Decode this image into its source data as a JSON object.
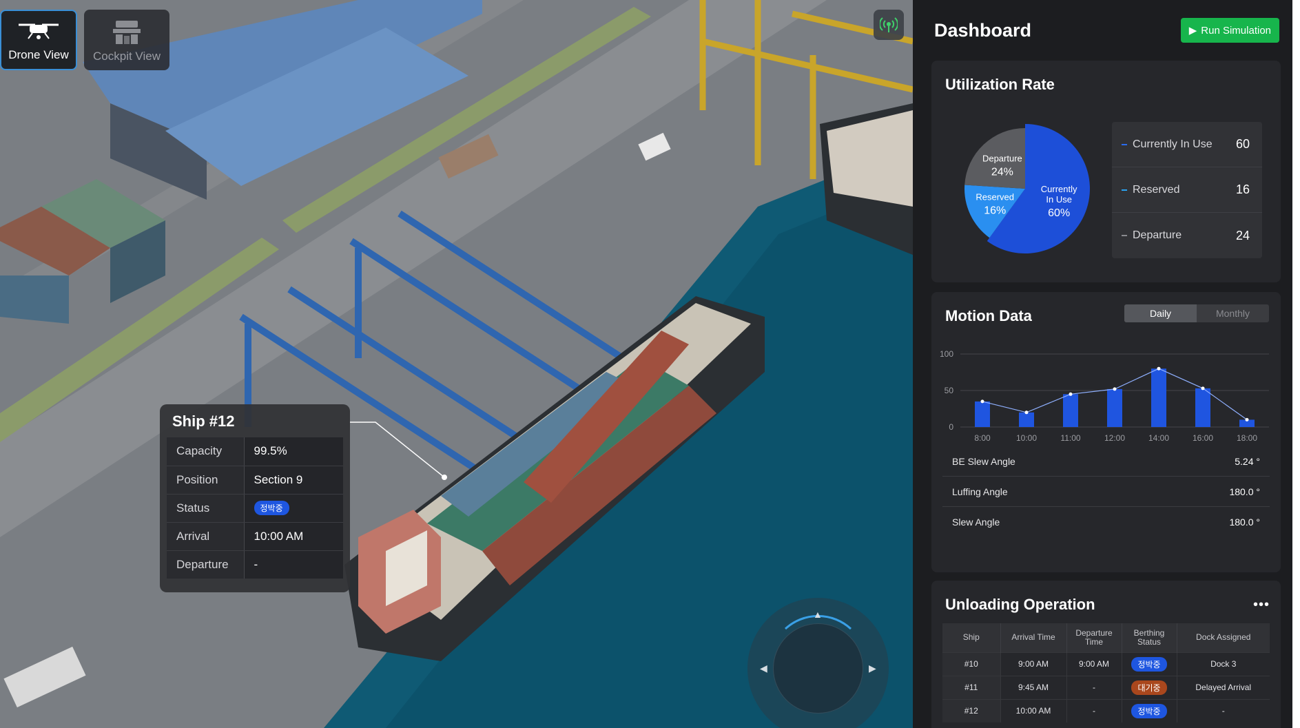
{
  "view_switch": {
    "drone_label": "Drone View",
    "cockpit_label": "Cockpit View",
    "active": "Drone View"
  },
  "ship_card": {
    "title": "Ship #12",
    "rows": [
      {
        "key": "Capacity",
        "value": "99.5%"
      },
      {
        "key": "Position",
        "value": "Section 9"
      },
      {
        "key": "Status",
        "value": "정박중",
        "badge": true
      },
      {
        "key": "Arrival",
        "value": "10:00 AM"
      },
      {
        "key": "Departure",
        "value": "-"
      }
    ]
  },
  "dashboard": {
    "title": "Dashboard",
    "run_button": "Run Simulation"
  },
  "utilization": {
    "title": "Utilization Rate",
    "slices": [
      {
        "label_line1": "Currently",
        "label_line2": "In Use",
        "pct_label": "60%",
        "value": 60,
        "color": "#1d4fd8"
      },
      {
        "label_line1": "Reserved",
        "label_line2": "",
        "pct_label": "16%",
        "value": 16,
        "color": "#2a8ff0"
      },
      {
        "label_line1": "Departure",
        "label_line2": "",
        "pct_label": "24%",
        "value": 24,
        "color": "#5b5c60"
      }
    ],
    "legend": [
      {
        "name": "Currently In Use",
        "value": "60",
        "color": "#2a6cf0"
      },
      {
        "name": "Reserved",
        "value": "16",
        "color": "#2aa3f0"
      },
      {
        "name": "Departure",
        "value": "24",
        "color": "#8a8b90"
      }
    ]
  },
  "motion": {
    "title": "Motion Data",
    "tabs": [
      "Daily",
      "Monthly"
    ],
    "active_tab": "Daily",
    "metrics": [
      {
        "name": "BE Slew Angle",
        "value": "5.24 °"
      },
      {
        "name": "Luffing Angle",
        "value": "180.0 °"
      },
      {
        "name": "Slew Angle",
        "value": "180.0 °"
      }
    ]
  },
  "chart_data": {
    "type": "bar",
    "categories": [
      "8:00",
      "10:00",
      "11:00",
      "12:00",
      "14:00",
      "16:00",
      "18:00"
    ],
    "values": [
      35,
      20,
      45,
      52,
      80,
      53,
      10
    ],
    "overlay_line": true,
    "title": "",
    "xlabel": "",
    "ylabel": "",
    "ylim": [
      0,
      100
    ],
    "yticks": [
      "0",
      "50",
      "100"
    ],
    "grid": true
  },
  "unloading": {
    "title": "Unloading Operation",
    "more_icon": "more-horizontal-icon",
    "columns": [
      "Ship",
      "Arrival Time",
      "Departure Time",
      "Berthing Status",
      "Dock Assigned"
    ],
    "rows": [
      {
        "ship": "#10",
        "arrival": "9:00 AM",
        "departure": "9:00 AM",
        "status": "정박중",
        "status_color": "#1e56e0",
        "dock": "Dock 3"
      },
      {
        "ship": "#11",
        "arrival": "9:45 AM",
        "departure": "-",
        "status": "대기중",
        "status_color": "#a9471d",
        "dock": "Delayed Arrival"
      },
      {
        "ship": "#12",
        "arrival": "10:00 AM",
        "departure": "-",
        "status": "정박중",
        "status_color": "#1e56e0",
        "dock": "-"
      }
    ]
  }
}
